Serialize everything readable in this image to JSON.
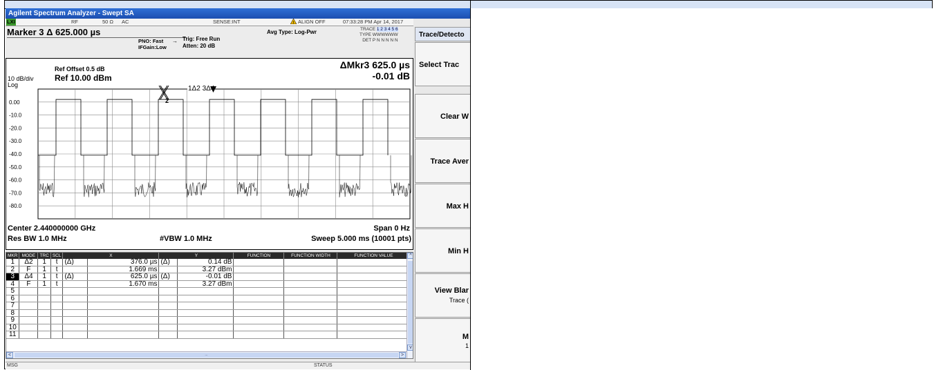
{
  "window": {
    "title": "Agilent Spectrum Analyzer - Swept SA"
  },
  "status_bar": {
    "lxi": "LXI",
    "rf": "RF",
    "impedance": "50 Ω",
    "coupling": "AC",
    "sense": "SENSE:INT",
    "align": "ALIGN OFF",
    "datetime": "07:33:28 PM Apr 14, 2017"
  },
  "header": {
    "marker_title": "Marker 3 Δ 625.000 µs",
    "pno": "PNO: Fast",
    "ifgain": "IFGain:Low",
    "trig": "Trig: Free Run",
    "atten": "Atten: 20 dB",
    "avg_type": "Avg Type: Log-Pwr",
    "trace_label": "TRACE",
    "trace_values": "1 2 3 4 5 6",
    "type_label": "TYPE",
    "type_values": "WWWWWW",
    "det_label": "DET",
    "det_values": "P N N N N N"
  },
  "screen": {
    "scale": "10 dB/div",
    "log": "Log",
    "ref_offset": "Ref Offset 0.5 dB",
    "ref_level": "Ref 10.00 dBm",
    "marker_readout_title": "ΔMkr3 625.0 µs",
    "marker_readout_value": "-0.01 dB",
    "y_ticks": [
      "0.00",
      "-10.0",
      "-20.0",
      "-30.0",
      "-40.0",
      "-50.0",
      "-60.0",
      "-70.0",
      "-80.0"
    ],
    "marker_x_label": "X",
    "marker_x_sub": "2",
    "marker_labels": "1Δ2 3Δ4",
    "center": "Center 2.440000000 GHz",
    "span": "Span 0 Hz",
    "rbw": "Res BW 1.0 MHz",
    "vbw": "#VBW 1.0 MHz",
    "sweep": "Sweep  5.000 ms (10001 pts)"
  },
  "marker_table": {
    "headers": [
      "MKR",
      "MODE",
      "TRC",
      "SCL",
      "X",
      "",
      "Y",
      "FUNCTION",
      "FUNCTION WIDTH",
      "FUNCTION VALUE"
    ],
    "rows": [
      {
        "mkr": "1",
        "mode": "Δ2",
        "trc": "1",
        "scl": "t",
        "xp": "(Δ)",
        "x": "376.0 µs",
        "yp": "(Δ)",
        "y": "0.14 dB"
      },
      {
        "mkr": "2",
        "mode": "F",
        "trc": "1",
        "scl": "t",
        "xp": "",
        "x": "1.669 ms",
        "yp": "",
        "y": "3.27 dBm"
      },
      {
        "mkr": "3",
        "mode": "Δ4",
        "trc": "1",
        "scl": "t",
        "xp": "(Δ)",
        "x": "625.0 µs",
        "yp": "(Δ)",
        "y": "-0.01 dB"
      },
      {
        "mkr": "4",
        "mode": "F",
        "trc": "1",
        "scl": "t",
        "xp": "",
        "x": "1.670 ms",
        "yp": "",
        "y": "3.27 dBm"
      },
      {
        "mkr": "5",
        "mode": "",
        "trc": "",
        "scl": "",
        "xp": "",
        "x": "",
        "yp": "",
        "y": ""
      },
      {
        "mkr": "6",
        "mode": "",
        "trc": "",
        "scl": "",
        "xp": "",
        "x": "",
        "yp": "",
        "y": ""
      },
      {
        "mkr": "7",
        "mode": "",
        "trc": "",
        "scl": "",
        "xp": "",
        "x": "",
        "yp": "",
        "y": ""
      },
      {
        "mkr": "8",
        "mode": "",
        "trc": "",
        "scl": "",
        "xp": "",
        "x": "",
        "yp": "",
        "y": ""
      },
      {
        "mkr": "9",
        "mode": "",
        "trc": "",
        "scl": "",
        "xp": "",
        "x": "",
        "yp": "",
        "y": ""
      },
      {
        "mkr": "10",
        "mode": "",
        "trc": "",
        "scl": "",
        "xp": "",
        "x": "",
        "yp": "",
        "y": ""
      },
      {
        "mkr": "11",
        "mode": "",
        "trc": "",
        "scl": "",
        "xp": "",
        "x": "",
        "yp": "",
        "y": ""
      }
    ],
    "selected_row": 2,
    "scroll_thumb_label": "..."
  },
  "softkeys": {
    "menu_title": "Trace/Detecto",
    "select_trace": "Select Trac",
    "clear_write": "Clear W",
    "trace_average": "Trace Aver",
    "max_hold": "Max H",
    "min_hold": "Min H",
    "view_blank": "View Blar",
    "view_blank_sub": "Trace (",
    "more": "M",
    "more_sub": "1"
  },
  "msgbar": {
    "msg": "MSG",
    "status": "STATUS"
  },
  "colors": {
    "title_bar": "#1c4fb0",
    "warning": "#e8b400",
    "lxi": "#3a9a2c",
    "strip": "#d7e3f5"
  }
}
